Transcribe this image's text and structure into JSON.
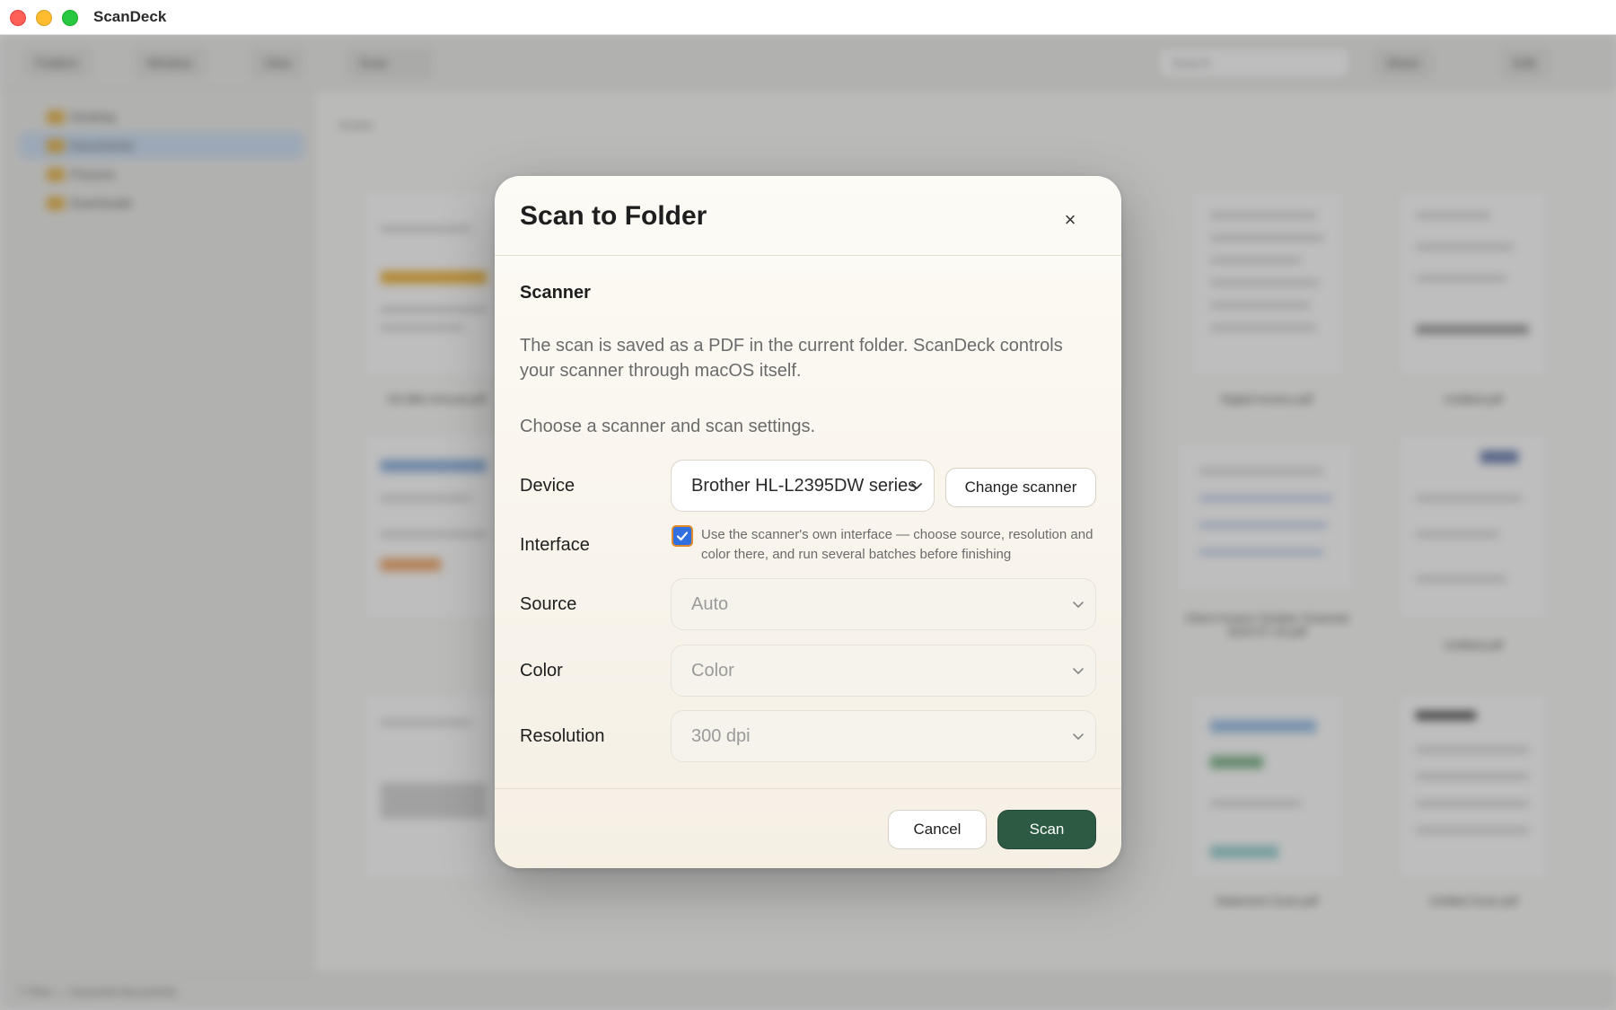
{
  "app": {
    "title": "ScanDeck"
  },
  "background": {
    "toolbar": [
      "Folders",
      "Window",
      "View",
      "Scan",
      "Share",
      "Edit"
    ],
    "search_placeholder": "Search",
    "sidebar": [
      "Desktop",
      "Documents",
      "Pictures",
      "Downloads"
    ],
    "breadcrumb": "Scans",
    "thumbs": [
      "SS Bills Annual.pdf",
      "Digital Invoice.pdf",
      "Untitled.pdf",
      "Client Invoice October Scanned 2024-07-16.pdf",
      "Untitled.pdf",
      "Statement Scan.pdf",
      "Untitled Scan.pdf"
    ],
    "status": "7 Files — Scanned documents"
  },
  "dialog": {
    "title": "Scan to Folder",
    "close": "×",
    "section": "Scanner",
    "description": "The scan is saved as a PDF in the current folder. ScanDeck controls your scanner through macOS itself.",
    "prompt": "Choose a scanner and scan settings.",
    "device": {
      "label": "Device",
      "value": "Brother HL-L2395DW series",
      "change_button": "Change scanner"
    },
    "interface": {
      "label": "Interface",
      "checked": true,
      "text": "Use the scanner's own interface — choose source, resolution and color there, and run several batches before finishing"
    },
    "source": {
      "label": "Source",
      "value": "Auto"
    },
    "color": {
      "label": "Color",
      "value": "Color"
    },
    "resolution": {
      "label": "Resolution",
      "value": "300 dpi"
    },
    "cancel": "Cancel",
    "scan": "Scan"
  },
  "colors": {
    "primary": "#2d5a43",
    "checkbox": "#2f6fe0",
    "checkbox_focus": "#e08a2d"
  }
}
